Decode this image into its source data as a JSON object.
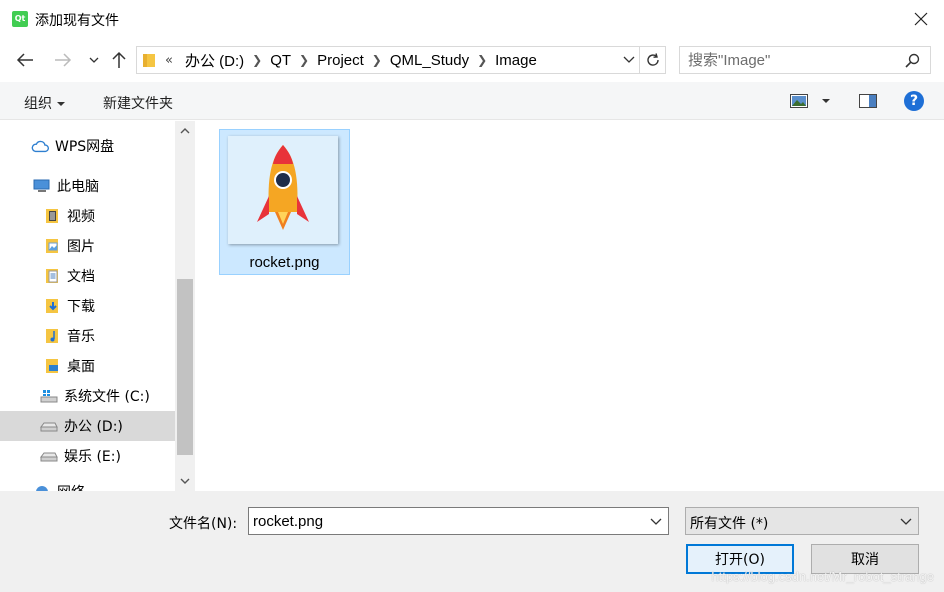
{
  "window": {
    "title": "添加现有文件",
    "app_icon_text": "Qt"
  },
  "address": {
    "overflow": "«",
    "crumbs": [
      "办公 (D:)",
      "QT",
      "Project",
      "QML_Study",
      "Image"
    ]
  },
  "search": {
    "placeholder": "搜索\"Image\""
  },
  "toolbar": {
    "organize_label": "组织",
    "new_folder_label": "新建文件夹",
    "help_label": "?"
  },
  "nav": {
    "items": [
      {
        "label": "WPS网盘",
        "icon": "cloud-icon"
      },
      {
        "label": "此电脑",
        "icon": "computer-icon"
      },
      {
        "label": "视频",
        "icon": "video-folder-icon"
      },
      {
        "label": "图片",
        "icon": "pictures-folder-icon"
      },
      {
        "label": "文档",
        "icon": "documents-folder-icon"
      },
      {
        "label": "下载",
        "icon": "downloads-folder-icon"
      },
      {
        "label": "音乐",
        "icon": "music-folder-icon"
      },
      {
        "label": "桌面",
        "icon": "desktop-folder-icon"
      },
      {
        "label": "系统文件 (C:)",
        "icon": "windows-drive-icon"
      },
      {
        "label": "办公 (D:)",
        "icon": "drive-icon",
        "selected": true
      },
      {
        "label": "娱乐 (E:)",
        "icon": "drive-icon"
      },
      {
        "label": "网络",
        "icon": "network-icon"
      }
    ]
  },
  "files": [
    {
      "name": "rocket.png",
      "selected": true
    }
  ],
  "bottom": {
    "filename_label": "文件名(N):",
    "filename_value": "rocket.png",
    "filter_value": "所有文件  (*)",
    "open_label": "打开(O)",
    "cancel_label": "取消"
  },
  "watermark": "https://blog.csdn.net/Mr_robot_strange",
  "colors": {
    "selection_bg": "#cce8ff",
    "selection_border": "#99d1ff",
    "accent": "#0078d7",
    "nav_selected": "#d9d9d9",
    "qt_green": "#41cd52"
  }
}
